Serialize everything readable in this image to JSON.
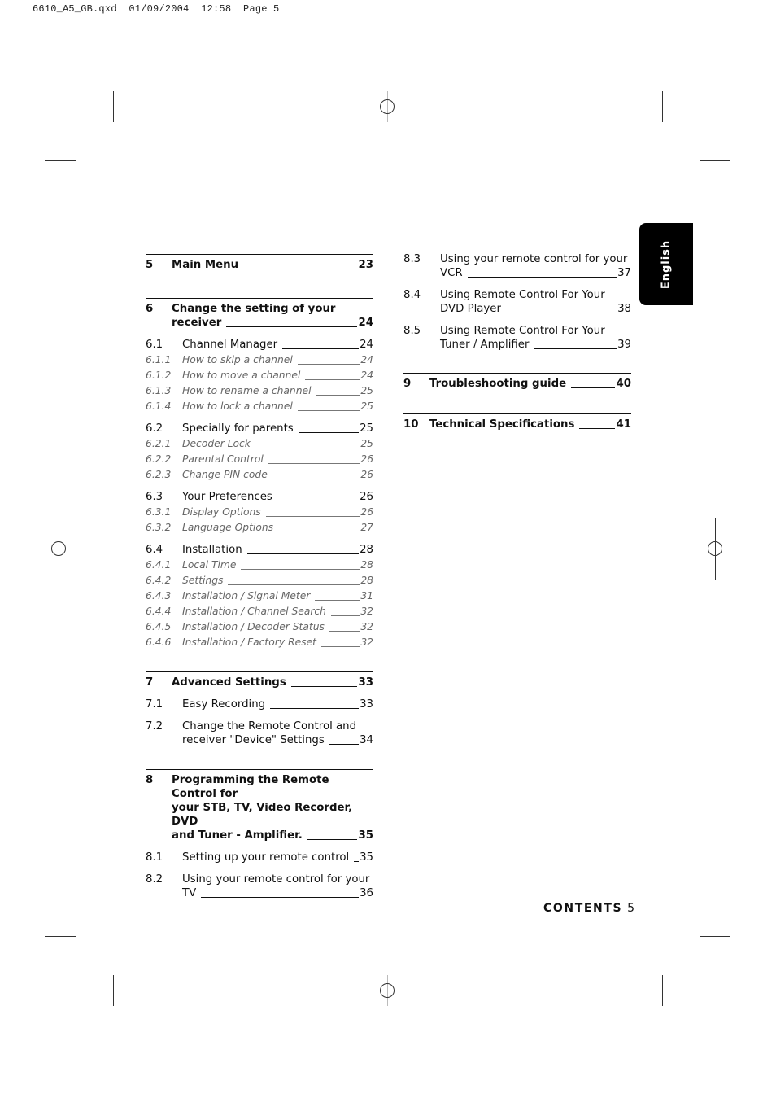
{
  "slug": "6610_A5_GB.qxd  01/09/2004  12:58  Page 5",
  "language_tab": "English",
  "footer": {
    "label": "CONTENTS",
    "page": "5"
  },
  "left_column": {
    "ch5": {
      "num": "5",
      "title": "Main Menu",
      "page": "23"
    },
    "ch6": {
      "num": "6",
      "title_line1": "Change the setting of your",
      "title_line2": "receiver",
      "page": "24"
    },
    "s6_1": {
      "num": "6.1",
      "title": "Channel Manager",
      "page": "24",
      "items": [
        {
          "num": "6.1.1",
          "title": "How to skip a channel",
          "page": "24"
        },
        {
          "num": "6.1.2",
          "title": "How to move a channel",
          "page": "24"
        },
        {
          "num": "6.1.3",
          "title": "How to rename a channel",
          "page": "25"
        },
        {
          "num": "6.1.4",
          "title": "How to lock a channel",
          "page": "25"
        }
      ]
    },
    "s6_2": {
      "num": "6.2",
      "title": "Specially for parents",
      "page": "25",
      "items": [
        {
          "num": "6.2.1",
          "title": "Decoder Lock",
          "page": "25"
        },
        {
          "num": "6.2.2",
          "title": "Parental Control",
          "page": "26"
        },
        {
          "num": "6.2.3",
          "title": "Change PIN code",
          "page": "26"
        }
      ]
    },
    "s6_3": {
      "num": "6.3",
      "title": "Your Preferences",
      "page": "26",
      "items": [
        {
          "num": "6.3.1",
          "title": "Display Options",
          "page": "26"
        },
        {
          "num": "6.3.2",
          "title": "Language Options",
          "page": "27"
        }
      ]
    },
    "s6_4": {
      "num": "6.4",
      "title": "Installation",
      "page": "28",
      "items": [
        {
          "num": "6.4.1",
          "title": "Local Time",
          "page": "28"
        },
        {
          "num": "6.4.2",
          "title": "Settings",
          "page": "28"
        },
        {
          "num": "6.4.3",
          "title": "Installation / Signal Meter",
          "page": "31"
        },
        {
          "num": "6.4.4",
          "title": "Installation / Channel Search",
          "page": "32"
        },
        {
          "num": "6.4.5",
          "title": "Installation / Decoder Status",
          "page": "32"
        },
        {
          "num": "6.4.6",
          "title": "Installation / Factory Reset",
          "page": "32"
        }
      ]
    },
    "ch7": {
      "num": "7",
      "title": "Advanced Settings",
      "page": "33"
    },
    "s7_1": {
      "num": "7.1",
      "title": "Easy Recording",
      "page": "33"
    },
    "s7_2": {
      "num": "7.2",
      "title_line1": "Change the Remote Control and",
      "title_line2": "receiver \"Device\" Settings",
      "page": "34"
    },
    "ch8": {
      "num": "8",
      "title_line1": "Programming the Remote Control for",
      "title_line2": "your STB, TV, Video Recorder, DVD",
      "title_line3": "and Tuner - Amplifier.",
      "page": "35"
    },
    "s8_1": {
      "num": "8.1",
      "title": "Setting up your remote control",
      "page": "35"
    },
    "s8_2": {
      "num": "8.2",
      "title_line1": "Using your remote control for your",
      "title_line2": "TV",
      "page": "36"
    }
  },
  "right_column": {
    "s8_3": {
      "num": "8.3",
      "title_line1": "Using your remote control for your",
      "title_line2": "VCR",
      "page": "37"
    },
    "s8_4": {
      "num": "8.4",
      "title_line1": "Using Remote Control For Your",
      "title_line2": "DVD Player",
      "page": "38"
    },
    "s8_5": {
      "num": "8.5",
      "title_line1": "Using Remote Control For Your",
      "title_line2": "Tuner / Amplifier",
      "page": "39"
    },
    "ch9": {
      "num": "9",
      "title": "Troubleshooting guide",
      "page": "40"
    },
    "ch10": {
      "num": "10",
      "title": "Technical Specifications",
      "page": "41"
    }
  }
}
